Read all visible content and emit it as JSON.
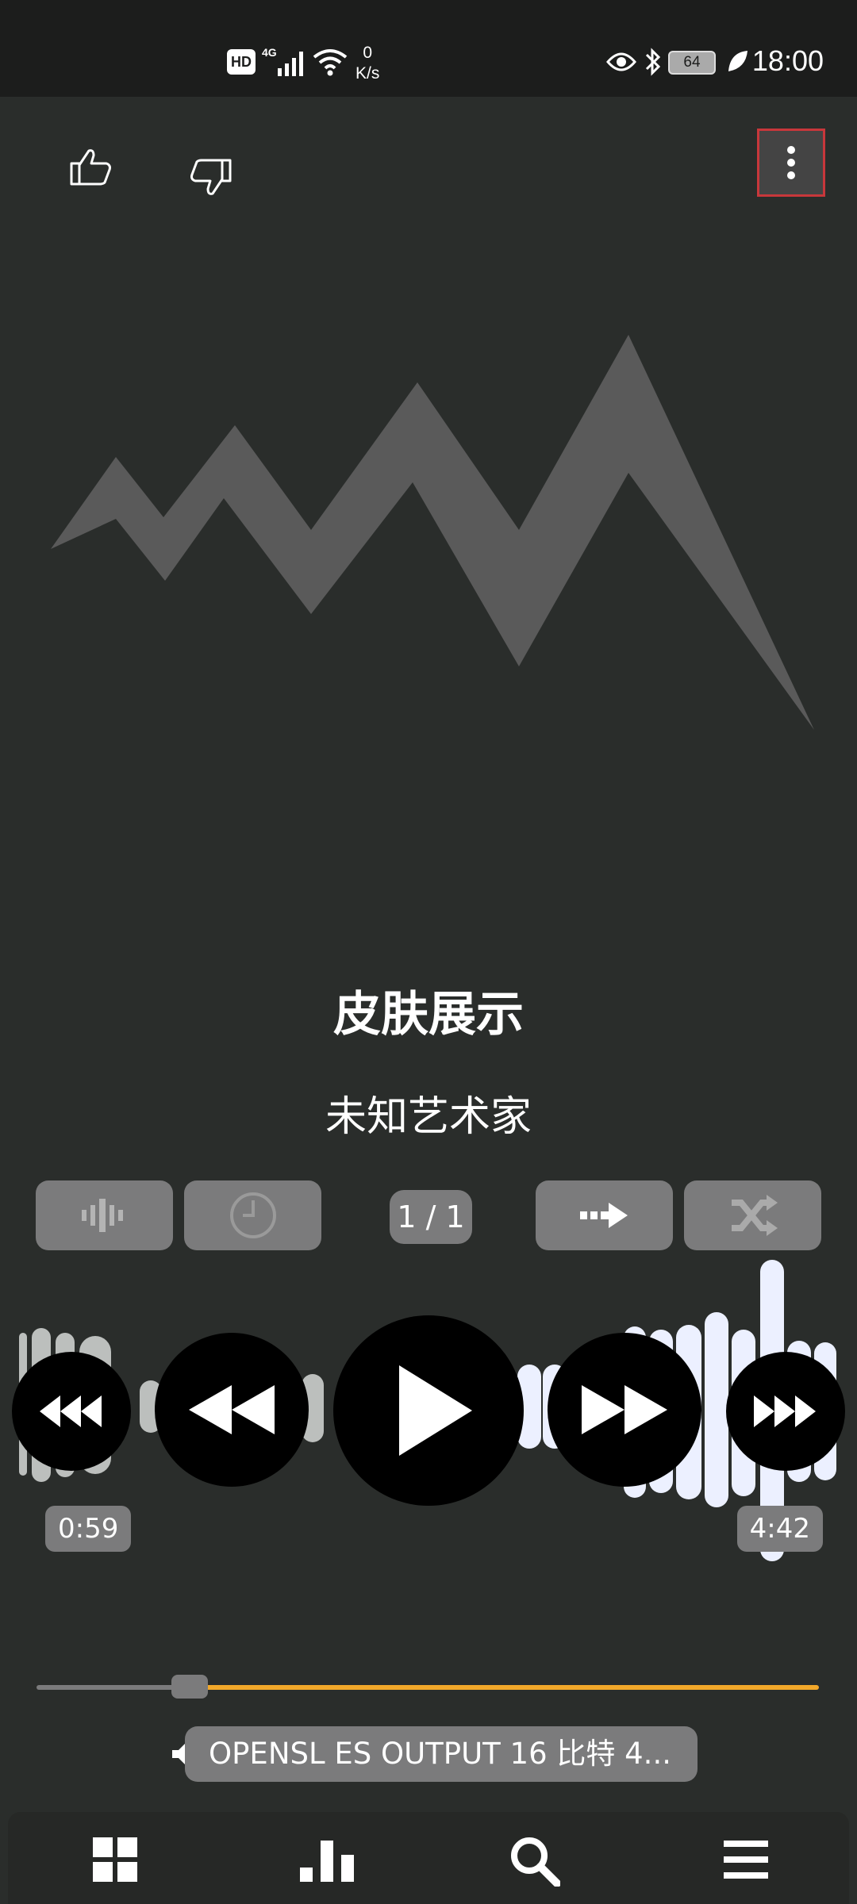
{
  "status_bar": {
    "network_badge": "HD",
    "signal_type": "4G",
    "speed_value": "0",
    "speed_unit": "K/s",
    "battery": "64",
    "time": "18:00"
  },
  "top_bar": {
    "like_icon": "thumbs-up-icon",
    "dislike_icon": "thumbs-down-icon",
    "menu_icon": "more-vert-icon"
  },
  "track": {
    "title": "皮肤展示",
    "artist": "未知艺术家"
  },
  "controls": {
    "queue_position": "1 / 1",
    "buttons": [
      "waveform-icon",
      "sleep-timer-icon",
      "repeat-icon",
      "shuffle-icon"
    ]
  },
  "playback": {
    "elapsed": "0:59",
    "duration": "4:42",
    "progress_fraction": 0.2
  },
  "output": {
    "text": "OPENSL ES OUTPUT  16 比特  4..."
  },
  "bottom_nav": [
    "grid-icon",
    "bar-chart-icon",
    "search-icon",
    "menu-icon"
  ],
  "colors": {
    "background": "#2a2d2b",
    "accent": "#f2a82a",
    "highlight": "#c8373b"
  }
}
